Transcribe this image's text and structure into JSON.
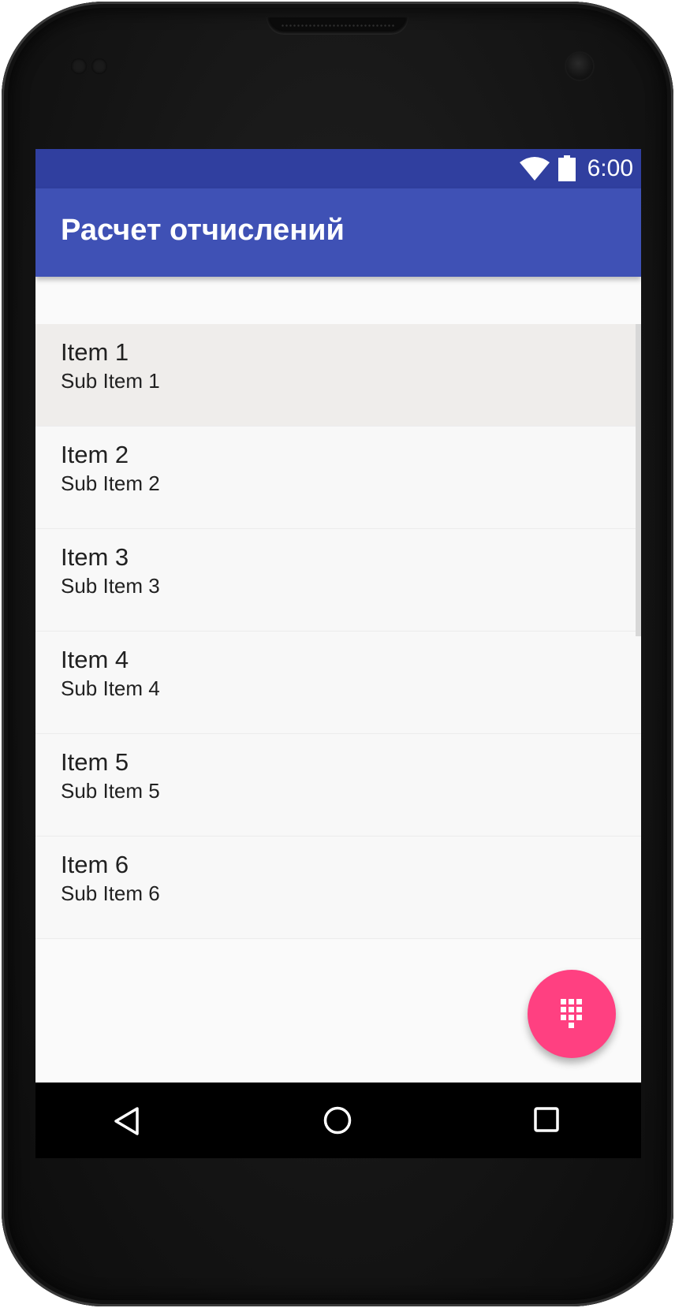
{
  "status_bar": {
    "time": "6:00",
    "icons": [
      "wifi-icon",
      "battery-icon"
    ],
    "color": "#303f9f"
  },
  "app_bar": {
    "title": "Расчет отчислений",
    "color": "#3f51b5"
  },
  "list": {
    "items": [
      {
        "title": "Item 1",
        "subtitle": "Sub Item 1",
        "selected": true
      },
      {
        "title": "Item 2",
        "subtitle": "Sub Item 2",
        "selected": false
      },
      {
        "title": "Item 3",
        "subtitle": "Sub Item 3",
        "selected": false
      },
      {
        "title": "Item 4",
        "subtitle": "Sub Item 4",
        "selected": false
      },
      {
        "title": "Item 5",
        "subtitle": "Sub Item 5",
        "selected": false
      },
      {
        "title": "Item 6",
        "subtitle": "Sub Item 6",
        "selected": false
      }
    ]
  },
  "fab": {
    "icon": "dialpad-icon",
    "color": "#ff4081"
  },
  "nav_bar": {
    "icons": [
      "back-icon",
      "home-icon",
      "recents-icon"
    ]
  }
}
